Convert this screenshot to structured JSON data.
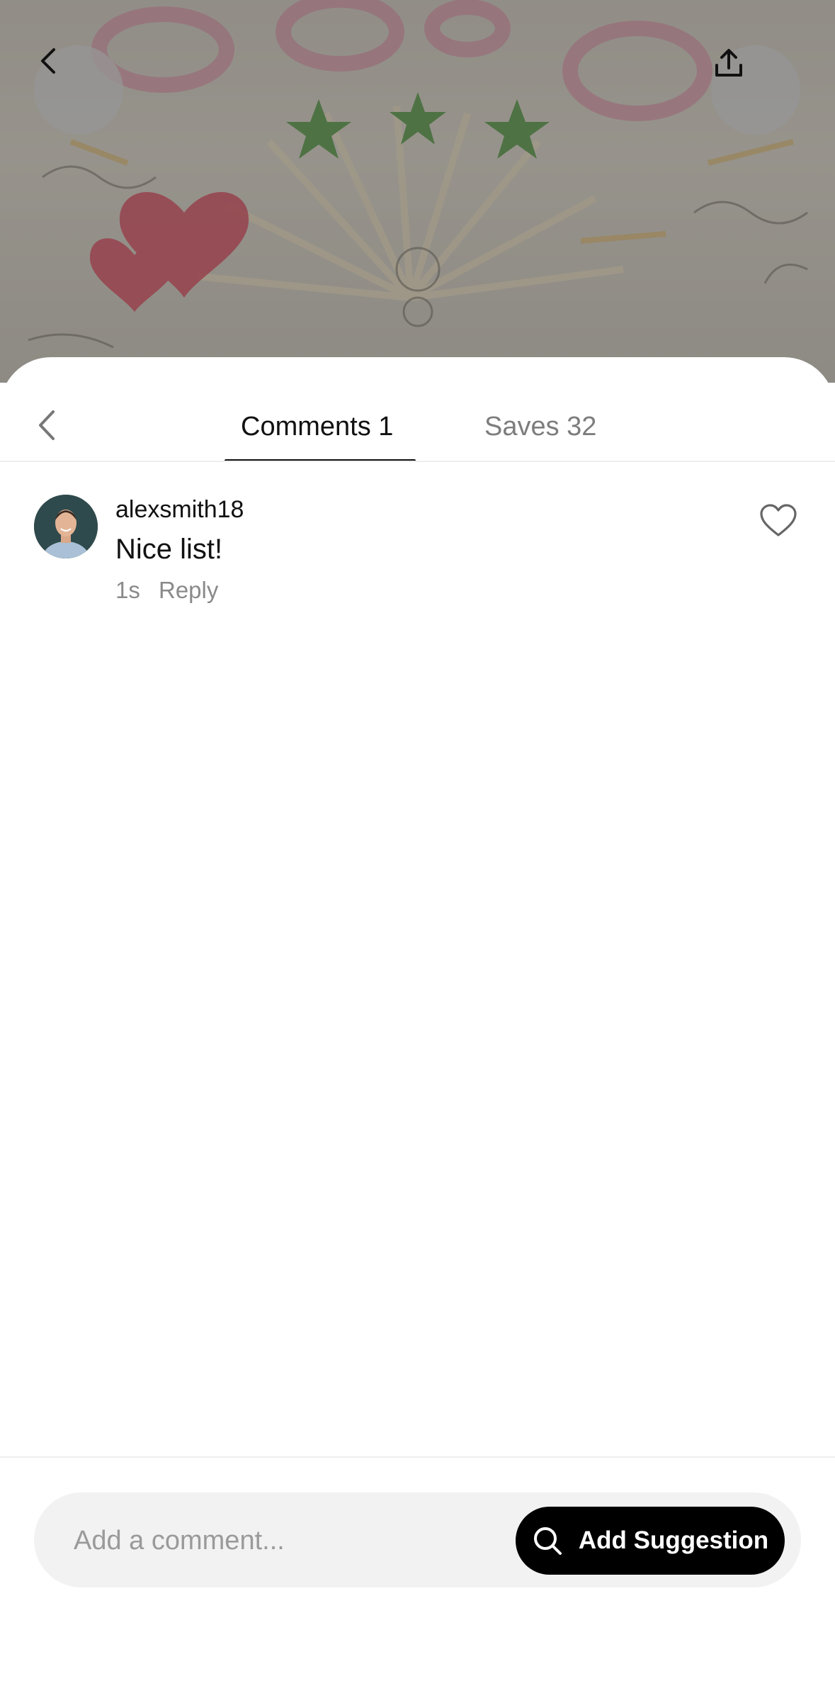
{
  "header": {
    "back_icon": "chevron-left-icon",
    "share_icon": "share-upload-icon"
  },
  "tabs": [
    {
      "label": "Comments 1",
      "active": true
    },
    {
      "label": "Saves 32",
      "active": false
    }
  ],
  "comments": [
    {
      "username": "alexsmith18",
      "text": "Nice list!",
      "time": "1s",
      "reply_label": "Reply",
      "like_icon": "heart-outline-icon"
    }
  ],
  "composer": {
    "placeholder": "Add a comment...",
    "button_label": "Add Suggestion",
    "button_icon": "search-icon"
  },
  "colors": {
    "active_tab": "#111111",
    "inactive_tab": "#7d7d7d",
    "button_bg": "#000000",
    "composer_bg": "#f2f2f2"
  }
}
